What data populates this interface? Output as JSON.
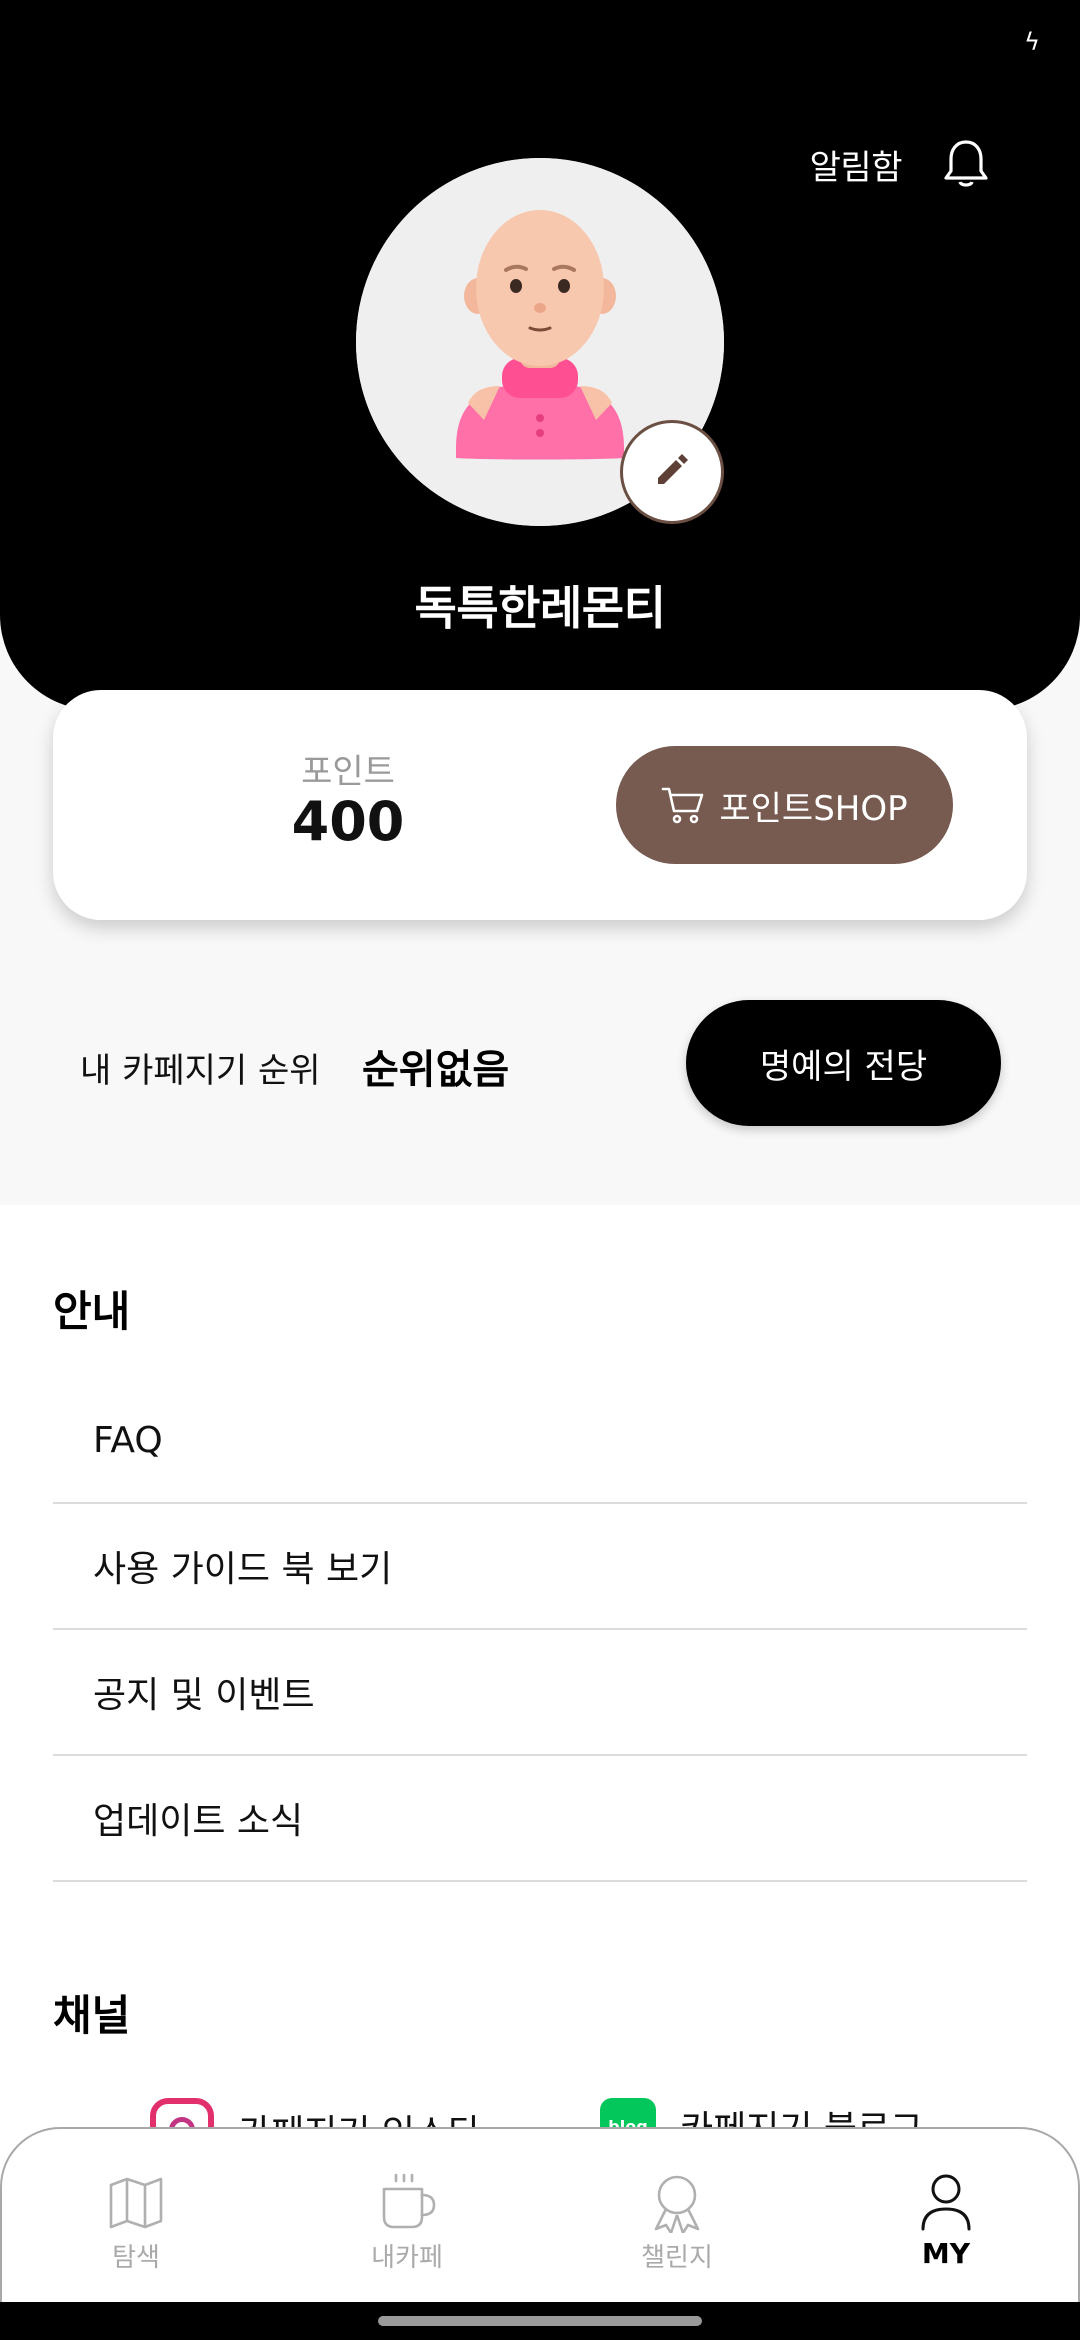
{
  "status_bar": {
    "icon": "charging-bolt-icon"
  },
  "header": {
    "notification_label": "알림함",
    "nickname": "독특한레몬티"
  },
  "points": {
    "label": "포인트",
    "value": "400",
    "shop_button_label": "포인트SHOP"
  },
  "ranking": {
    "label": "내 카페지기 순위",
    "value": "순위없음",
    "hall_of_fame_button": "명예의 전당"
  },
  "info_section": {
    "title": "안내",
    "items": [
      {
        "label": "FAQ"
      },
      {
        "label": "사용 가이드 북 보기"
      },
      {
        "label": "공지 및 이벤트"
      },
      {
        "label": "업데이트 소식"
      }
    ]
  },
  "channel_section": {
    "title": "채널",
    "items": [
      {
        "label": "카페지기 인스타",
        "icon": "instagram-icon"
      },
      {
        "label": "카페지기 블로그",
        "icon": "blog-icon",
        "icon_text": "blog"
      }
    ]
  },
  "bottom_nav": {
    "items": [
      {
        "label": "탐색",
        "icon": "map-icon",
        "active": false
      },
      {
        "label": "내카페",
        "icon": "coffee-cup-icon",
        "active": false
      },
      {
        "label": "챌린지",
        "icon": "award-ribbon-icon",
        "active": false
      },
      {
        "label": "MY",
        "icon": "person-icon",
        "active": true
      }
    ]
  },
  "colors": {
    "header_bg": "#000000",
    "shop_button": "#775a50",
    "edit_border": "#6b4f43",
    "section_bg": "#f8f8f8",
    "inactive_nav": "#aaaaaa"
  }
}
